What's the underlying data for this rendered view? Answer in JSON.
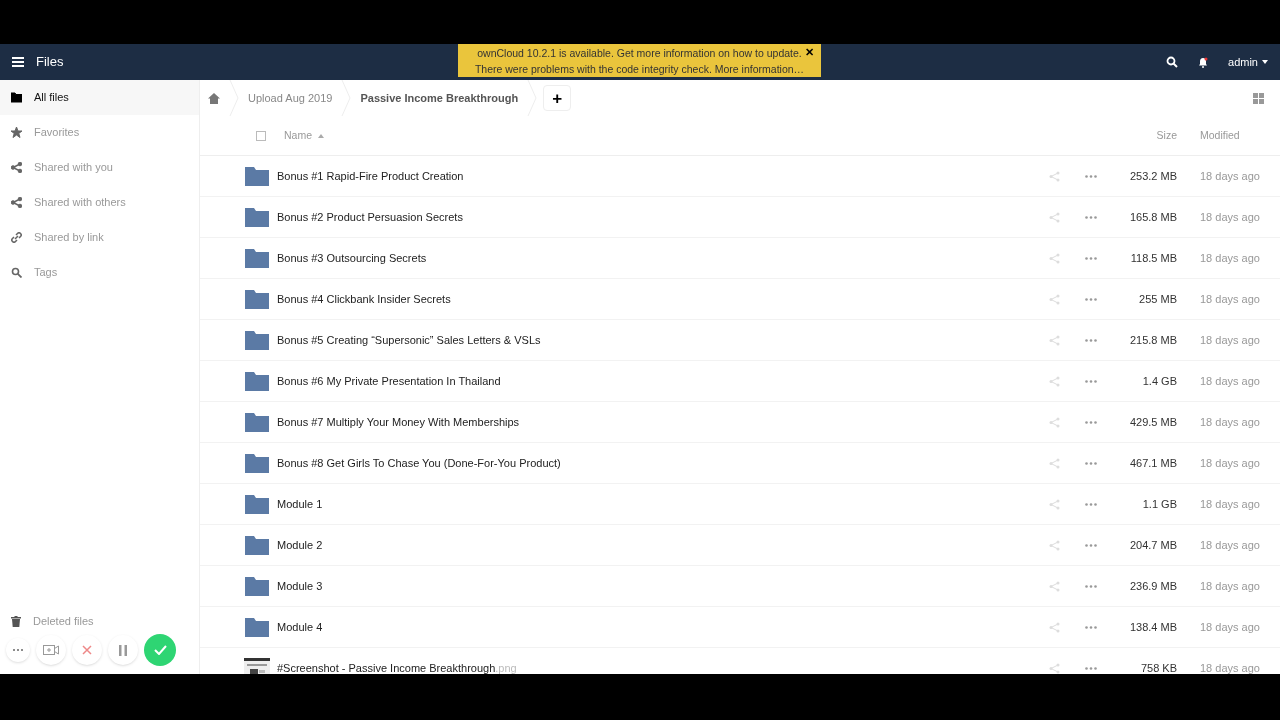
{
  "header": {
    "app_title": "Files",
    "user": "admin"
  },
  "notification": {
    "lines": [
      "ownCloud 10.2.1 is available. Get more information on how to update.",
      "There were problems with the code integrity check. More information…"
    ],
    "close": "✕"
  },
  "sidebar": {
    "items": [
      {
        "label": "All files",
        "selected": true
      },
      {
        "label": "Favorites",
        "selected": false
      },
      {
        "label": "Shared with you",
        "selected": false
      },
      {
        "label": "Shared with others",
        "selected": false
      },
      {
        "label": "Shared by link",
        "selected": false
      },
      {
        "label": "Tags",
        "selected": false
      }
    ],
    "footer": {
      "label": "Deleted files"
    }
  },
  "breadcrumbs": [
    "Upload Aug 2019",
    "Passive Income Breakthrough"
  ],
  "new_button": "+",
  "table": {
    "select_all_checked": false,
    "columns": [
      "Name",
      "Size",
      "Modified"
    ],
    "rows": [
      {
        "kind": "folder",
        "name": "Bonus #1 Rapid-Fire Product Creation",
        "size": "253.2 MB",
        "modified": "18 days ago"
      },
      {
        "kind": "folder",
        "name": "Bonus #2 Product Persuasion Secrets",
        "size": "165.8 MB",
        "modified": "18 days ago"
      },
      {
        "kind": "folder",
        "name": "Bonus #3 Outsourcing Secrets",
        "size": "118.5 MB",
        "modified": "18 days ago"
      },
      {
        "kind": "folder",
        "name": "Bonus #4 Clickbank Insider Secrets",
        "size": "255 MB",
        "modified": "18 days ago"
      },
      {
        "kind": "folder",
        "name": "Bonus #5 Creating “Supersonic” Sales Letters & VSLs",
        "size": "215.8 MB",
        "modified": "18 days ago"
      },
      {
        "kind": "folder",
        "name": "Bonus #6 My Private Presentation In Thailand",
        "size": "1.4 GB",
        "modified": "18 days ago"
      },
      {
        "kind": "folder",
        "name": "Bonus #7 Multiply Your Money With Memberships",
        "size": "429.5 MB",
        "modified": "18 days ago"
      },
      {
        "kind": "folder",
        "name": "Bonus #8 Get Girls To Chase You (Done-For-You Product)",
        "size": "467.1 MB",
        "modified": "18 days ago"
      },
      {
        "kind": "folder",
        "name": "Module 1",
        "size": "1.1 GB",
        "modified": "18 days ago"
      },
      {
        "kind": "folder",
        "name": "Module 2",
        "size": "204.7 MB",
        "modified": "18 days ago"
      },
      {
        "kind": "folder",
        "name": "Module 3",
        "size": "236.9 MB",
        "modified": "18 days ago"
      },
      {
        "kind": "folder",
        "name": "Module 4",
        "size": "138.4 MB",
        "modified": "18 days ago"
      },
      {
        "kind": "image",
        "name": "#Screenshot - Passive Income Breakthrough",
        "extension": ".png",
        "size": "758 KB",
        "modified": "18 days ago"
      }
    ]
  }
}
